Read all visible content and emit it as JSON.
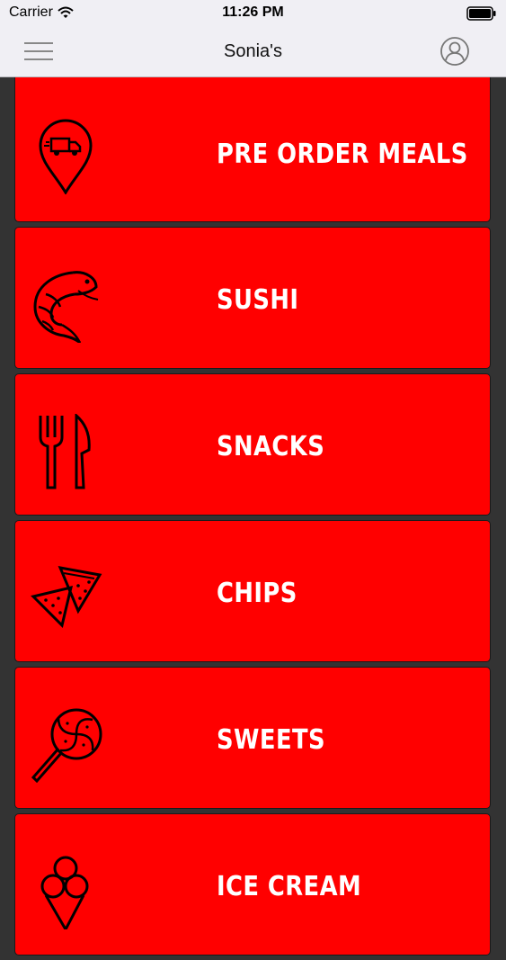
{
  "status_bar": {
    "carrier": "Carrier",
    "time": "11:26 PM"
  },
  "nav": {
    "title": "Sonia's",
    "menu_icon": "hamburger-menu-icon",
    "profile_icon": "user-profile-icon"
  },
  "categories": [
    {
      "label": "PRE ORDER MEALS",
      "icon": "delivery-location-icon"
    },
    {
      "label": "SUSHI",
      "icon": "shrimp-icon"
    },
    {
      "label": "SNACKS",
      "icon": "fork-knife-icon"
    },
    {
      "label": "CHIPS",
      "icon": "tortilla-chips-icon"
    },
    {
      "label": "SWEETS",
      "icon": "lollipop-icon"
    },
    {
      "label": "ICE CREAM",
      "icon": "ice-cream-icon"
    }
  ],
  "colors": {
    "tile_background": "#ff0000",
    "page_background": "#333333",
    "nav_background": "#f0eff4",
    "label_color": "#ffffff"
  }
}
